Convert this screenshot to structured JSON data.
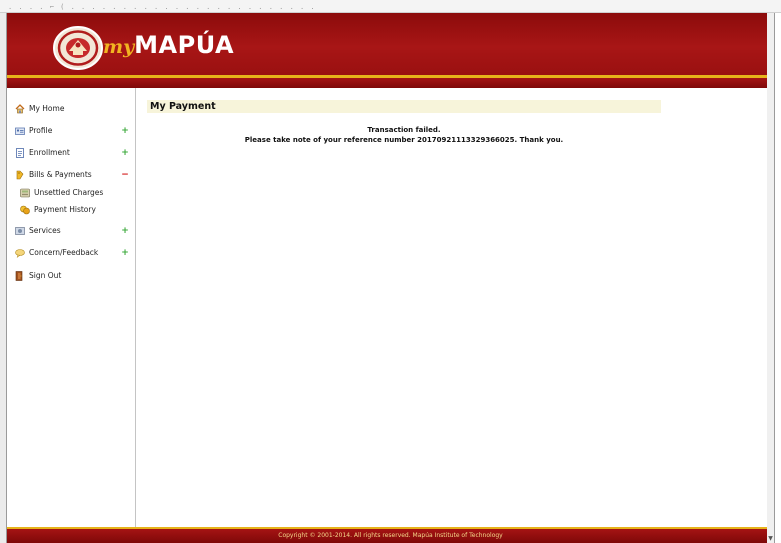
{
  "header": {
    "logo_prefix": "my",
    "logo_brand": "MAPÚA",
    "seal_icon": "university-seal-icon",
    "colors": {
      "header_red": "#a81616",
      "accent_gold": "#e7b31a",
      "logo_my": "#f2b421"
    }
  },
  "sidebar": {
    "items": [
      {
        "label": "My Home",
        "icon": "home-icon",
        "expander": ""
      },
      {
        "label": "Profile",
        "icon": "id-card-icon",
        "expander": "+"
      },
      {
        "label": "Enrollment",
        "icon": "document-icon",
        "expander": "+"
      },
      {
        "label": "Bills & Payments",
        "icon": "money-icon",
        "expander": "−"
      },
      {
        "label": "Unsettled Charges",
        "icon": "calculator-icon",
        "expander": ""
      },
      {
        "label": "Payment History",
        "icon": "coins-icon",
        "expander": ""
      },
      {
        "label": "Services",
        "icon": "services-icon",
        "expander": "+"
      },
      {
        "label": "Concern/Feedback",
        "icon": "chat-bubble-icon",
        "expander": "+"
      },
      {
        "label": "Sign Out",
        "icon": "exit-door-icon",
        "expander": ""
      }
    ]
  },
  "content": {
    "title": "My Payment",
    "message_line1": "Transaction failed.",
    "message_line2": "Please take note of your reference number 20170921113329366025. Thank you."
  },
  "footer": {
    "copyright": "Copyright © 2001-2014. All rights reserved. Mapúa Institute of Technology"
  }
}
